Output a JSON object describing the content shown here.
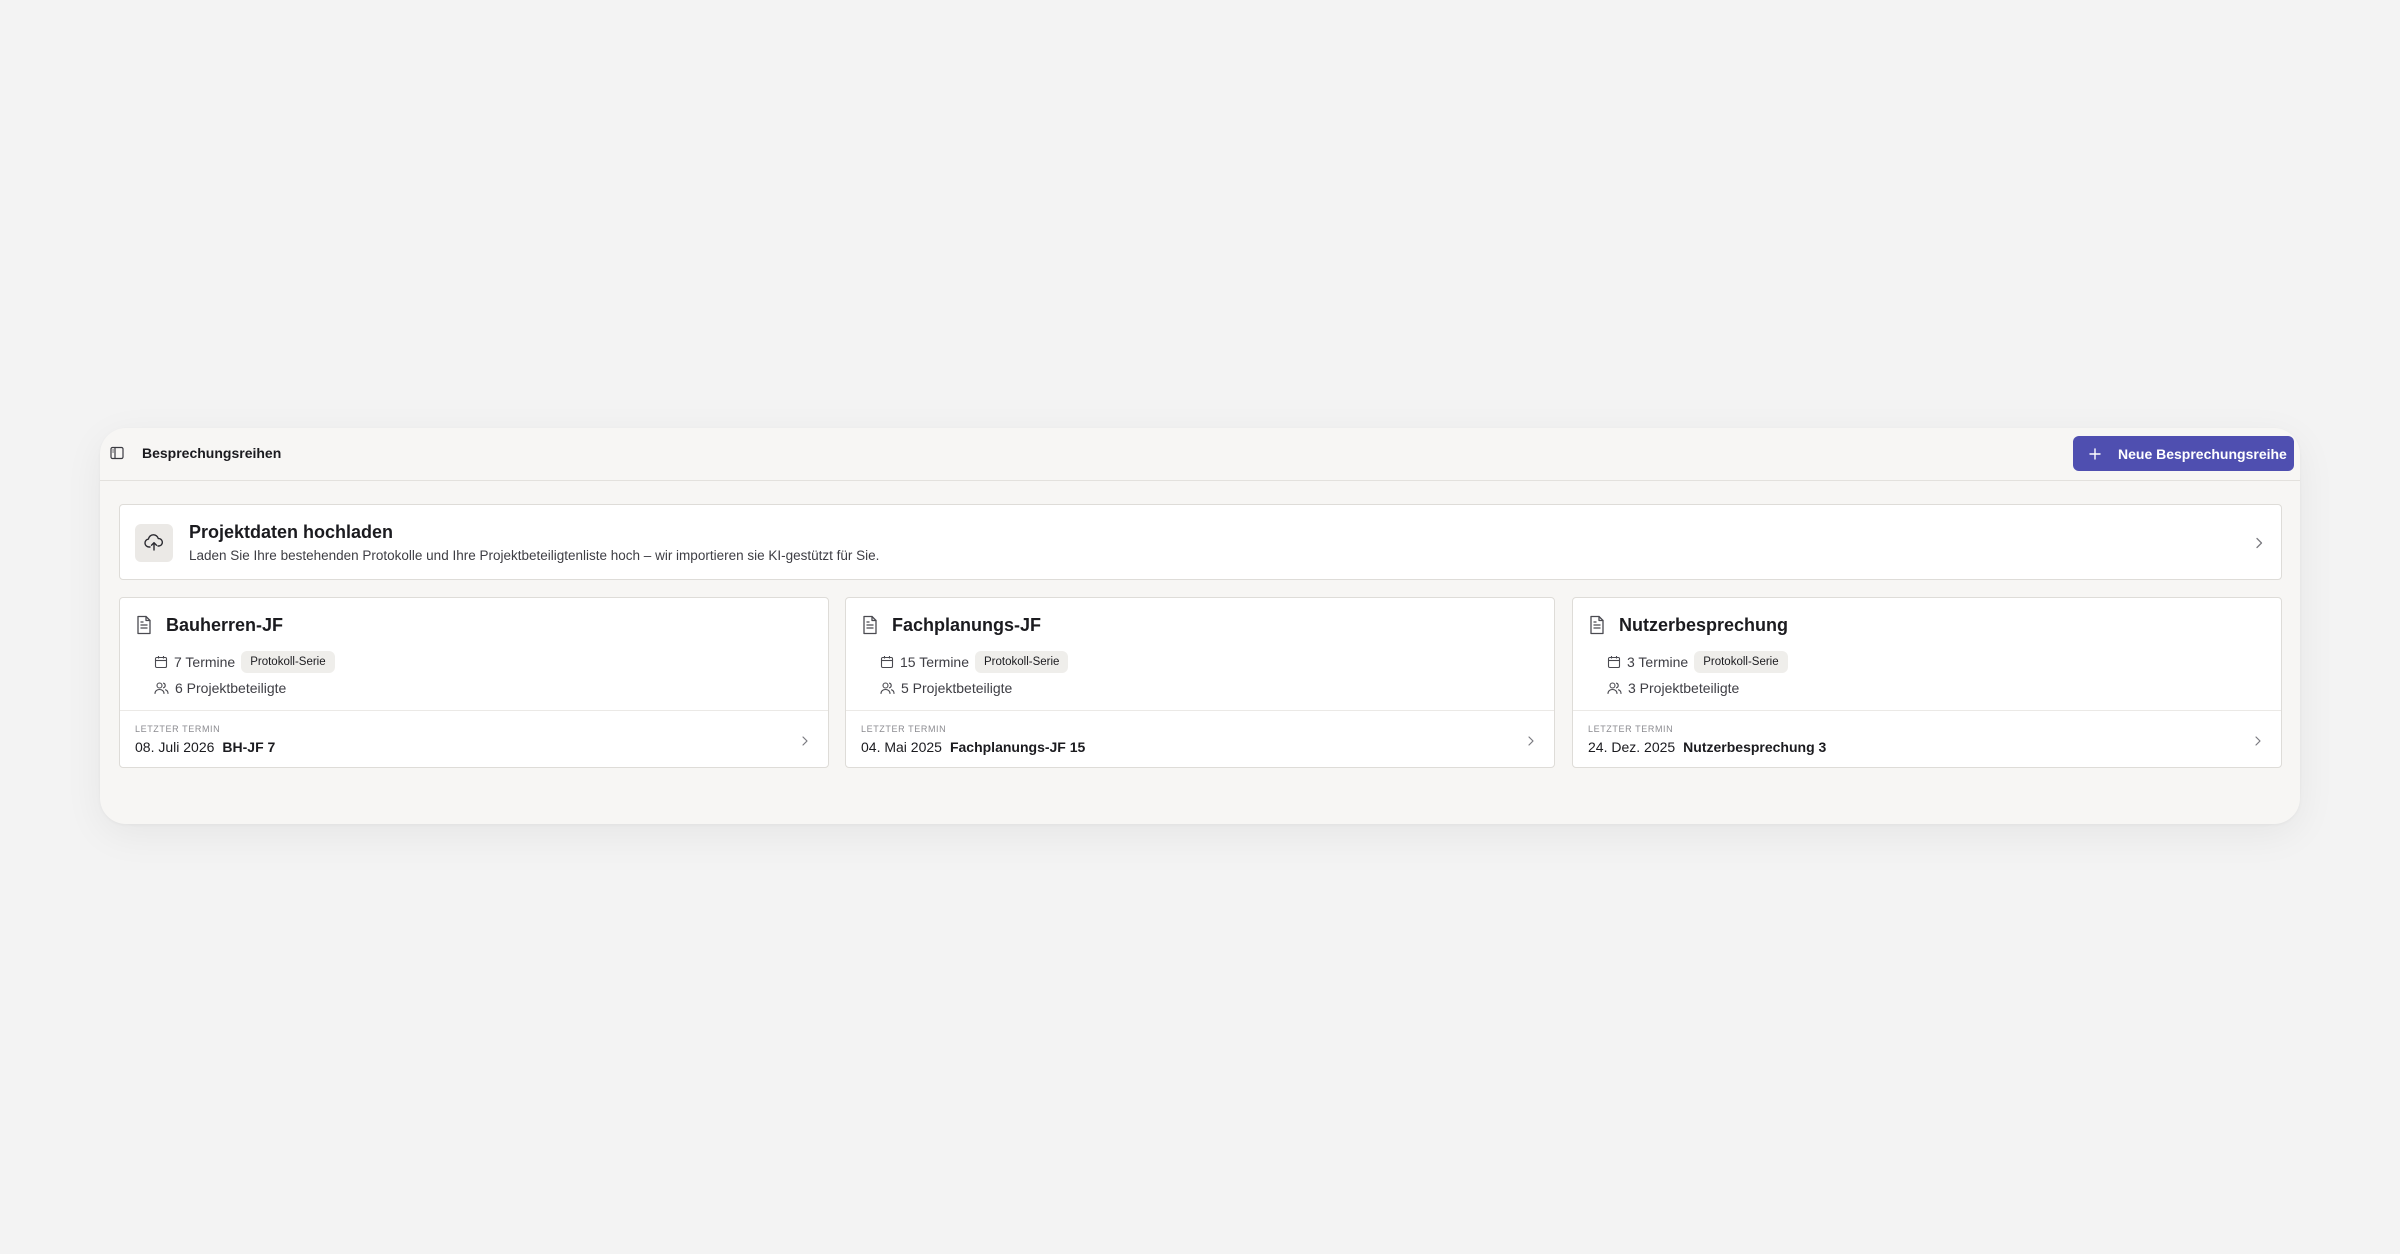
{
  "topbar": {
    "title": "Besprechungsreihen",
    "new_button_label": "Neue Besprechungsreihe",
    "accent_color": "#4f4fb0"
  },
  "upload": {
    "title": "Projektdaten hochladen",
    "description": "Laden Sie Ihre bestehenden Protokolle und Ihre Projektbeteiligtenliste hoch – wir importieren sie KI-gestützt für Sie.",
    "icon": "cloud-upload-icon"
  },
  "series": [
    {
      "name": "Bauherren-JF",
      "termine": "7 Termine",
      "badge": "Protokoll-Serie",
      "beteiligte": "6 Projektbeteiligte",
      "last_label": "Letzter Termin",
      "last_date": "08. Juli 2026",
      "last_name": "BH-JF 7"
    },
    {
      "name": "Fachplanungs-JF",
      "termine": "15 Termine",
      "badge": "Protokoll-Serie",
      "beteiligte": "5 Projektbeteiligte",
      "last_label": "Letzter Termin",
      "last_date": "04. Mai 2025",
      "last_name": "Fachplanungs-JF 15"
    },
    {
      "name": "Nutzerbesprechung",
      "termine": "3 Termine",
      "badge": "Protokoll-Serie",
      "beteiligte": "3 Projektbeteiligte",
      "last_label": "Letzter Termin",
      "last_date": "24. Dez. 2025",
      "last_name": "Nutzerbesprechung 3"
    }
  ]
}
